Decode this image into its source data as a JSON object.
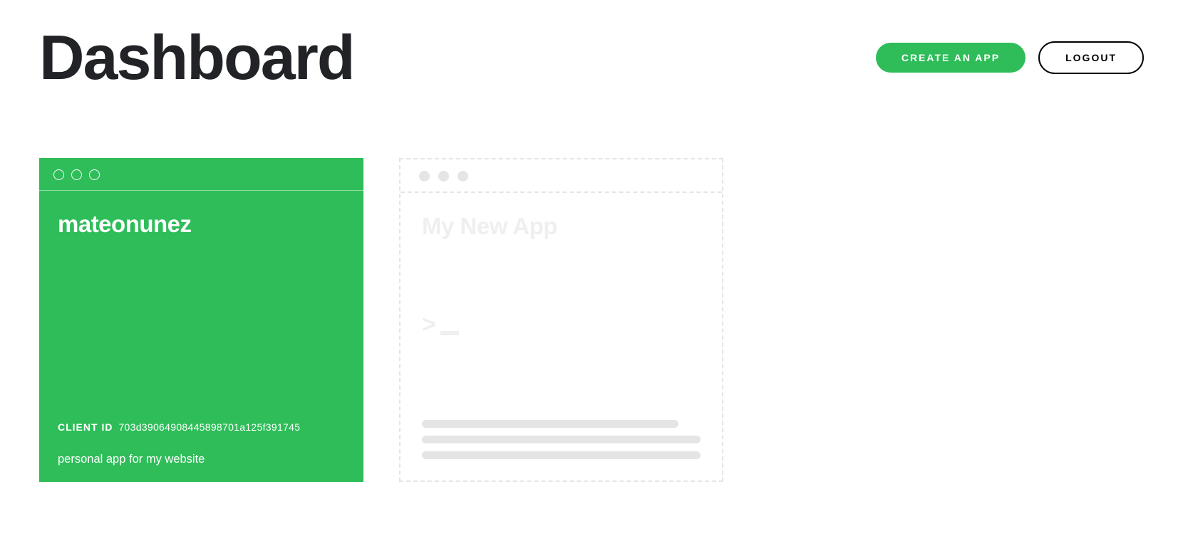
{
  "header": {
    "title": "Dashboard",
    "create_app_button": "CREATE AN APP",
    "logout_button": "LOGOUT"
  },
  "apps": [
    {
      "name": "mateonunez",
      "client_id_label": "CLIENT ID",
      "client_id": "703d39064908445898701a125f391745",
      "description": "personal app for my website"
    }
  ],
  "placeholder": {
    "title": "My New App",
    "prompt": ">"
  },
  "colors": {
    "accent": "#2ebd59",
    "text_dark": "#222326",
    "placeholder_gray": "#e5e5e5"
  }
}
